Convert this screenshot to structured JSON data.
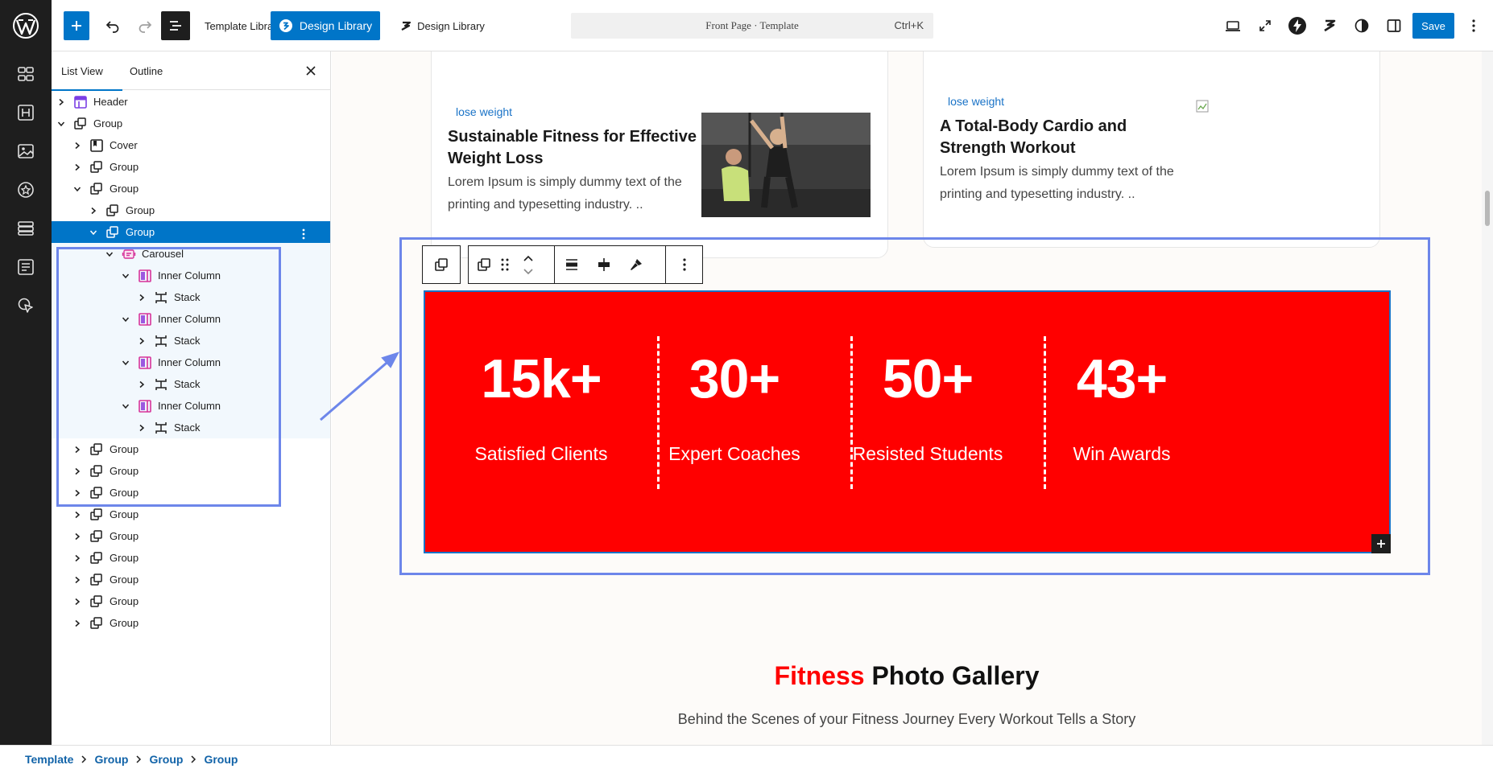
{
  "topbar": {
    "template_library_label": "Template Library",
    "design_library_primary": "Design Library",
    "design_library_secondary": "Design Library",
    "document_title": "Front Page · Template",
    "shortcut": "Ctrl+K",
    "save_label": "Save"
  },
  "panel": {
    "tabs": [
      {
        "label": "List View"
      },
      {
        "label": "Outline"
      }
    ],
    "tree": [
      {
        "label": "Header",
        "level": 0,
        "expanded": false,
        "icon": "header-icon"
      },
      {
        "label": "Group",
        "level": 0,
        "expanded": true,
        "icon": "group-icon"
      },
      {
        "label": "Cover",
        "level": 1,
        "expanded": false,
        "icon": "cover-icon"
      },
      {
        "label": "Group",
        "level": 1,
        "expanded": false,
        "icon": "group-icon"
      },
      {
        "label": "Group",
        "level": 1,
        "expanded": true,
        "icon": "group-icon"
      },
      {
        "label": "Group",
        "level": 2,
        "expanded": false,
        "icon": "group-icon"
      },
      {
        "label": "Group",
        "level": 2,
        "expanded": true,
        "icon": "group-icon",
        "selected": true
      },
      {
        "label": "Carousel",
        "level": 3,
        "expanded": true,
        "icon": "carousel-icon"
      },
      {
        "label": "Inner Column",
        "level": 4,
        "expanded": true,
        "icon": "column-icon"
      },
      {
        "label": "Stack",
        "level": 5,
        "expanded": false,
        "icon": "stack-icon"
      },
      {
        "label": "Inner Column",
        "level": 4,
        "expanded": true,
        "icon": "column-icon"
      },
      {
        "label": "Stack",
        "level": 5,
        "expanded": false,
        "icon": "stack-icon"
      },
      {
        "label": "Inner Column",
        "level": 4,
        "expanded": true,
        "icon": "column-icon"
      },
      {
        "label": "Stack",
        "level": 5,
        "expanded": false,
        "icon": "stack-icon"
      },
      {
        "label": "Inner Column",
        "level": 4,
        "expanded": true,
        "icon": "column-icon"
      },
      {
        "label": "Stack",
        "level": 5,
        "expanded": false,
        "icon": "stack-icon"
      },
      {
        "label": "Group",
        "level": 1,
        "expanded": false,
        "icon": "group-icon"
      },
      {
        "label": "Group",
        "level": 1,
        "expanded": false,
        "icon": "group-icon"
      },
      {
        "label": "Group",
        "level": 1,
        "expanded": false,
        "icon": "group-icon"
      },
      {
        "label": "Group",
        "level": 1,
        "expanded": false,
        "icon": "group-icon"
      },
      {
        "label": "Group",
        "level": 1,
        "expanded": false,
        "icon": "group-icon"
      },
      {
        "label": "Group",
        "level": 1,
        "expanded": false,
        "icon": "group-icon"
      },
      {
        "label": "Group",
        "level": 1,
        "expanded": false,
        "icon": "group-icon"
      },
      {
        "label": "Group",
        "level": 1,
        "expanded": false,
        "icon": "group-icon"
      },
      {
        "label": "Group",
        "level": 1,
        "expanded": false,
        "icon": "group-icon"
      }
    ]
  },
  "canvas": {
    "cards": [
      {
        "category": "lose weight",
        "title": "Sustainable Fitness for Effective Weight Loss",
        "excerpt": "Lorem Ipsum is simply dummy text of the printing and typesetting industry. .."
      },
      {
        "category": "lose weight",
        "title": "A Total-Body Cardio and Strength Workout",
        "excerpt": "Lorem Ipsum is simply dummy text of the printing and typesetting industry. .."
      }
    ],
    "stats": [
      {
        "number": "15k+",
        "label": "Satisfied Clients"
      },
      {
        "number": "30+",
        "label": "Expert Coaches"
      },
      {
        "number": "50+",
        "label": "Resisted Students"
      },
      {
        "number": "43+",
        "label": "Win Awards"
      }
    ],
    "gallery": {
      "title_accent": "Fitness",
      "title_rest": " Photo Gallery",
      "subtitle": "Behind the Scenes of your Fitness Journey Every Workout Tells a Story"
    }
  },
  "breadcrumb": [
    "Template",
    "Group",
    "Group",
    "Group"
  ],
  "colors": {
    "accent": "#0075c8",
    "stats_background": "#ff0000",
    "highlight_outline": "#6d86ea",
    "category_link": "#1a73c7"
  }
}
